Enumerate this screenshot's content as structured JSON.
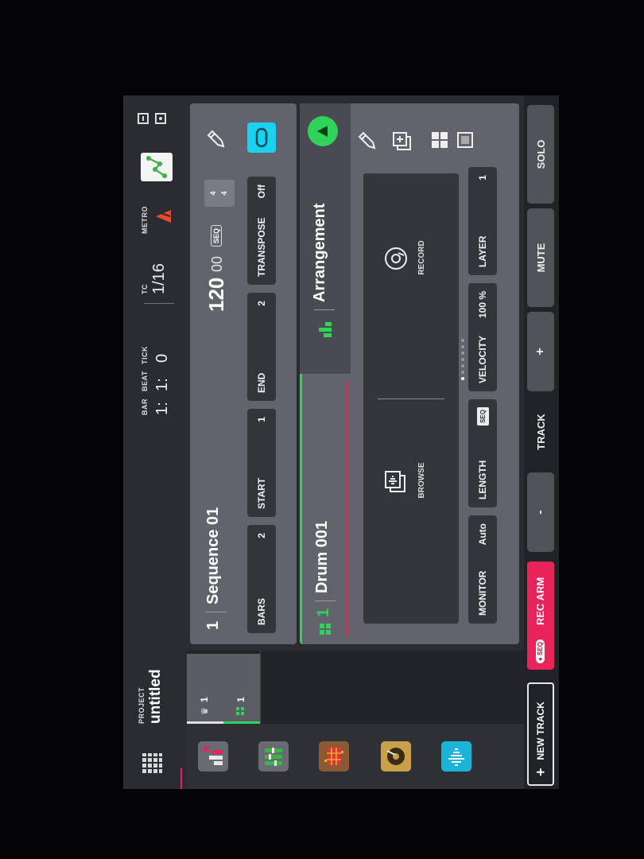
{
  "project": {
    "label": "PROJECT",
    "name": "untitled"
  },
  "transport": {
    "bar_label": "BAR",
    "beat_label": "BEAT",
    "tick_label": "TICK",
    "bar": "1:",
    "beat": "1:",
    "tick": "0",
    "tc_label": "TC",
    "tc_value": "1/16",
    "metro_label": "METRO"
  },
  "sequence": {
    "number": "1",
    "name": "Sequence 01",
    "bpm": "120",
    "bpm_decimal": "00",
    "seq_badge": "SEQ",
    "time_sig_top": "4",
    "time_sig_bottom": "4",
    "bars_label": "BARS",
    "bars_value": "2",
    "start_label": "START",
    "start_value": "1",
    "end_label": "END",
    "end_value": "2",
    "transpose_label": "TRANSPOSE",
    "transpose_value": "Off"
  },
  "track": {
    "number": "1",
    "name": "Drum 001",
    "view_label": "Arrangement",
    "browse_label": "BROWSE",
    "record_label": "RECORD",
    "monitor_label": "MONITOR",
    "monitor_value": "Auto",
    "length_label": "LENGTH",
    "length_badge": "SEQ",
    "velocity_label": "VELOCITY",
    "velocity_value": "100 %",
    "layer_label": "LAYER",
    "layer_value": "1"
  },
  "track_list": [
    {
      "number": "1",
      "icon": "crown-icon"
    },
    {
      "number": "1",
      "icon": "grid-icon"
    }
  ],
  "bottom": {
    "new_track_label": "NEW TRACK",
    "new_track_icon": "+",
    "seq_tag": "SEQ",
    "rec_arm_label": "REC ARM",
    "minus_label": "-",
    "track_label": "TRACK",
    "plus_label": "+",
    "mute_label": "MUTE",
    "solo_label": "SOLO"
  },
  "colors": {
    "accent_green": "#2fd35a",
    "rec_arm": "#e8245b",
    "loop_cyan": "#1bd1f0",
    "metro_red": "#e64a2e"
  }
}
